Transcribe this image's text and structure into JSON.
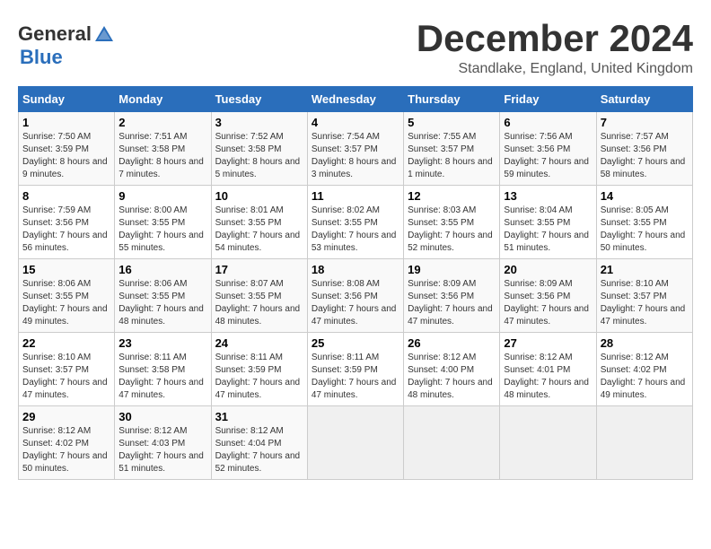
{
  "logo": {
    "general": "General",
    "blue": "Blue"
  },
  "title": {
    "month": "December 2024",
    "location": "Standlake, England, United Kingdom"
  },
  "headers": [
    "Sunday",
    "Monday",
    "Tuesday",
    "Wednesday",
    "Thursday",
    "Friday",
    "Saturday"
  ],
  "weeks": [
    [
      {
        "day": "1",
        "sunrise": "Sunrise: 7:50 AM",
        "sunset": "Sunset: 3:59 PM",
        "daylight": "Daylight: 8 hours and 9 minutes."
      },
      {
        "day": "2",
        "sunrise": "Sunrise: 7:51 AM",
        "sunset": "Sunset: 3:58 PM",
        "daylight": "Daylight: 8 hours and 7 minutes."
      },
      {
        "day": "3",
        "sunrise": "Sunrise: 7:52 AM",
        "sunset": "Sunset: 3:58 PM",
        "daylight": "Daylight: 8 hours and 5 minutes."
      },
      {
        "day": "4",
        "sunrise": "Sunrise: 7:54 AM",
        "sunset": "Sunset: 3:57 PM",
        "daylight": "Daylight: 8 hours and 3 minutes."
      },
      {
        "day": "5",
        "sunrise": "Sunrise: 7:55 AM",
        "sunset": "Sunset: 3:57 PM",
        "daylight": "Daylight: 8 hours and 1 minute."
      },
      {
        "day": "6",
        "sunrise": "Sunrise: 7:56 AM",
        "sunset": "Sunset: 3:56 PM",
        "daylight": "Daylight: 7 hours and 59 minutes."
      },
      {
        "day": "7",
        "sunrise": "Sunrise: 7:57 AM",
        "sunset": "Sunset: 3:56 PM",
        "daylight": "Daylight: 7 hours and 58 minutes."
      }
    ],
    [
      {
        "day": "8",
        "sunrise": "Sunrise: 7:59 AM",
        "sunset": "Sunset: 3:56 PM",
        "daylight": "Daylight: 7 hours and 56 minutes."
      },
      {
        "day": "9",
        "sunrise": "Sunrise: 8:00 AM",
        "sunset": "Sunset: 3:55 PM",
        "daylight": "Daylight: 7 hours and 55 minutes."
      },
      {
        "day": "10",
        "sunrise": "Sunrise: 8:01 AM",
        "sunset": "Sunset: 3:55 PM",
        "daylight": "Daylight: 7 hours and 54 minutes."
      },
      {
        "day": "11",
        "sunrise": "Sunrise: 8:02 AM",
        "sunset": "Sunset: 3:55 PM",
        "daylight": "Daylight: 7 hours and 53 minutes."
      },
      {
        "day": "12",
        "sunrise": "Sunrise: 8:03 AM",
        "sunset": "Sunset: 3:55 PM",
        "daylight": "Daylight: 7 hours and 52 minutes."
      },
      {
        "day": "13",
        "sunrise": "Sunrise: 8:04 AM",
        "sunset": "Sunset: 3:55 PM",
        "daylight": "Daylight: 7 hours and 51 minutes."
      },
      {
        "day": "14",
        "sunrise": "Sunrise: 8:05 AM",
        "sunset": "Sunset: 3:55 PM",
        "daylight": "Daylight: 7 hours and 50 minutes."
      }
    ],
    [
      {
        "day": "15",
        "sunrise": "Sunrise: 8:06 AM",
        "sunset": "Sunset: 3:55 PM",
        "daylight": "Daylight: 7 hours and 49 minutes."
      },
      {
        "day": "16",
        "sunrise": "Sunrise: 8:06 AM",
        "sunset": "Sunset: 3:55 PM",
        "daylight": "Daylight: 7 hours and 48 minutes."
      },
      {
        "day": "17",
        "sunrise": "Sunrise: 8:07 AM",
        "sunset": "Sunset: 3:55 PM",
        "daylight": "Daylight: 7 hours and 48 minutes."
      },
      {
        "day": "18",
        "sunrise": "Sunrise: 8:08 AM",
        "sunset": "Sunset: 3:56 PM",
        "daylight": "Daylight: 7 hours and 47 minutes."
      },
      {
        "day": "19",
        "sunrise": "Sunrise: 8:09 AM",
        "sunset": "Sunset: 3:56 PM",
        "daylight": "Daylight: 7 hours and 47 minutes."
      },
      {
        "day": "20",
        "sunrise": "Sunrise: 8:09 AM",
        "sunset": "Sunset: 3:56 PM",
        "daylight": "Daylight: 7 hours and 47 minutes."
      },
      {
        "day": "21",
        "sunrise": "Sunrise: 8:10 AM",
        "sunset": "Sunset: 3:57 PM",
        "daylight": "Daylight: 7 hours and 47 minutes."
      }
    ],
    [
      {
        "day": "22",
        "sunrise": "Sunrise: 8:10 AM",
        "sunset": "Sunset: 3:57 PM",
        "daylight": "Daylight: 7 hours and 47 minutes."
      },
      {
        "day": "23",
        "sunrise": "Sunrise: 8:11 AM",
        "sunset": "Sunset: 3:58 PM",
        "daylight": "Daylight: 7 hours and 47 minutes."
      },
      {
        "day": "24",
        "sunrise": "Sunrise: 8:11 AM",
        "sunset": "Sunset: 3:59 PM",
        "daylight": "Daylight: 7 hours and 47 minutes."
      },
      {
        "day": "25",
        "sunrise": "Sunrise: 8:11 AM",
        "sunset": "Sunset: 3:59 PM",
        "daylight": "Daylight: 7 hours and 47 minutes."
      },
      {
        "day": "26",
        "sunrise": "Sunrise: 8:12 AM",
        "sunset": "Sunset: 4:00 PM",
        "daylight": "Daylight: 7 hours and 48 minutes."
      },
      {
        "day": "27",
        "sunrise": "Sunrise: 8:12 AM",
        "sunset": "Sunset: 4:01 PM",
        "daylight": "Daylight: 7 hours and 48 minutes."
      },
      {
        "day": "28",
        "sunrise": "Sunrise: 8:12 AM",
        "sunset": "Sunset: 4:02 PM",
        "daylight": "Daylight: 7 hours and 49 minutes."
      }
    ],
    [
      {
        "day": "29",
        "sunrise": "Sunrise: 8:12 AM",
        "sunset": "Sunset: 4:02 PM",
        "daylight": "Daylight: 7 hours and 50 minutes."
      },
      {
        "day": "30",
        "sunrise": "Sunrise: 8:12 AM",
        "sunset": "Sunset: 4:03 PM",
        "daylight": "Daylight: 7 hours and 51 minutes."
      },
      {
        "day": "31",
        "sunrise": "Sunrise: 8:12 AM",
        "sunset": "Sunset: 4:04 PM",
        "daylight": "Daylight: 7 hours and 52 minutes."
      },
      null,
      null,
      null,
      null
    ]
  ]
}
